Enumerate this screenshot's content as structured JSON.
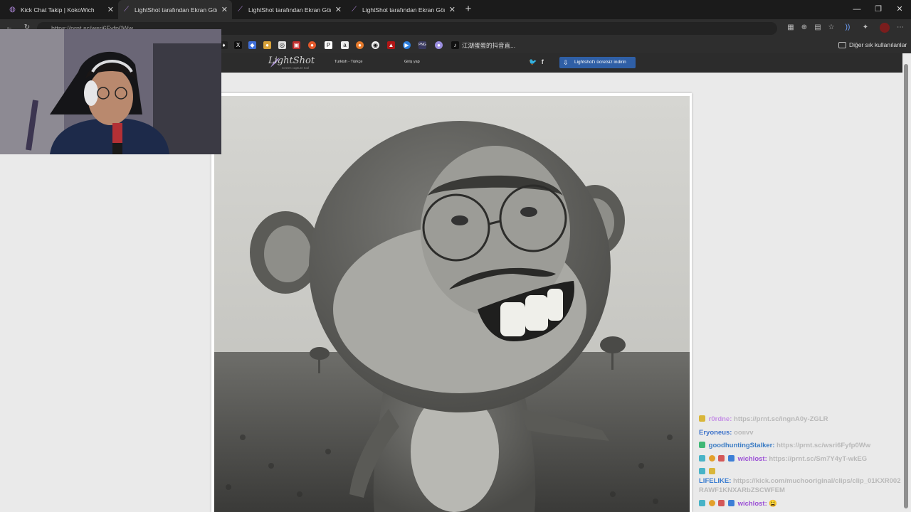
{
  "tabs": [
    {
      "title": "Kick Chat Takip | KokoWich",
      "icon": "globe-icon"
    },
    {
      "title": "LightShot tarafından Ekran Görüntü",
      "icon": "lightshot-feather-icon",
      "active": true
    },
    {
      "title": "LightShot tarafından Ekran Görüntü",
      "icon": "lightshot-feather-icon"
    },
    {
      "title": "LightShot tarafından Ekran Görüntü",
      "icon": "lightshot-feather-icon"
    }
  ],
  "address_bar": {
    "url": "https://prnt.sc/wsri6Fyfp0Ww"
  },
  "bookmarks": {
    "last_label": "江湖蛋蛋的抖音直...",
    "other_label": "Diğer sık kullanılanlar"
  },
  "lightshot": {
    "logo": "LightShot",
    "logo_sub": "screen capture tool",
    "language": "Turkish - Türkçe",
    "login": "Giriş yap",
    "download": "Lightshot'ı ücretsiz indirin"
  },
  "chat": [
    {
      "user": "r0rdne:",
      "text": "https://prnt.sc/ingnA0y-ZGLR",
      "user_color": "#c58fe6"
    },
    {
      "user": "Eryoneus:",
      "text": "ooııvv",
      "user_color": "#3d72c9"
    },
    {
      "user": "goodhuntingStalker:",
      "text": "https://prnt.sc/wsri6Fyfp0Ww",
      "user_color": "#3b7cc4"
    },
    {
      "user": "wichlost:",
      "text": "https://prnt.sc/Sm7Y4yT-wkEG",
      "user_color": "#9b4fd6"
    },
    {
      "user": "LIFELIKE:",
      "text": "https://kick.com/muchooriginal/clips/clip_01KXR002",
      "user_color": "#3c7ed1"
    },
    {
      "user": "",
      "text": "RAWF1KNXARbZSCWFEM",
      "user_color": "#3c7ed1"
    },
    {
      "user": "wichlost:",
      "text": "😩",
      "user_color": "#9b4fd6"
    }
  ],
  "colors": {
    "download_button": "#2f5fa6",
    "header_bg": "#2c2c2c",
    "page_bg": "#eaeaea"
  }
}
